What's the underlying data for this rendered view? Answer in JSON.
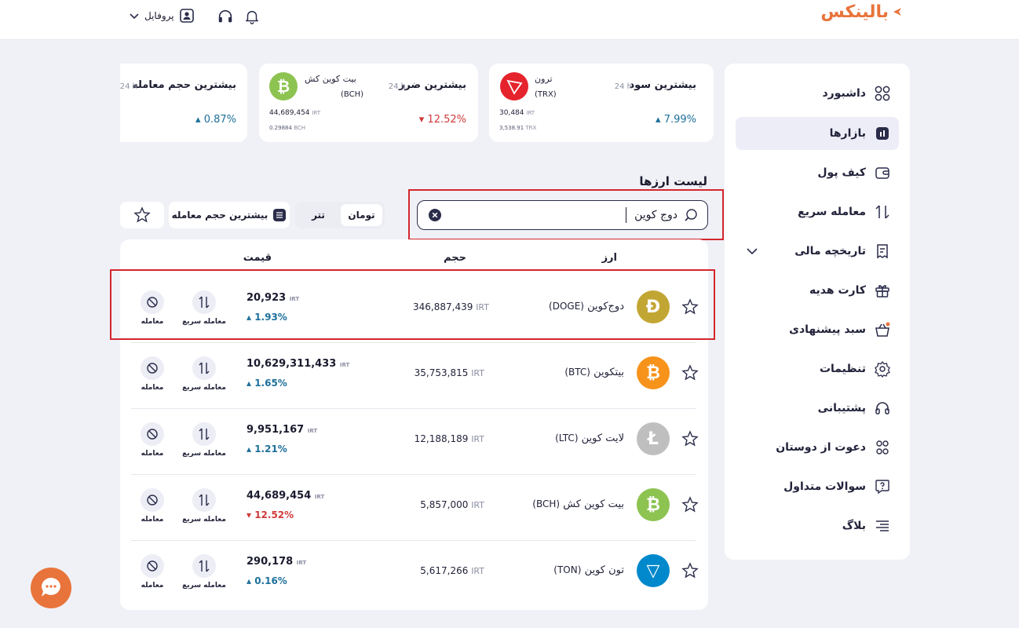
{
  "header": {
    "logo_text": "بالینکس",
    "profile_label": "پروفایل",
    "icons": [
      "user-icon",
      "headphones-icon",
      "bell-icon",
      "chevron-down-icon"
    ]
  },
  "sidebar": {
    "items": [
      {
        "label": "داشبورد",
        "icon": "grid-icon",
        "active": false
      },
      {
        "label": "بازارها",
        "icon": "chart-icon",
        "active": true
      },
      {
        "label": "کیف پول",
        "icon": "wallet-icon",
        "active": false
      },
      {
        "label": "معامله سریع",
        "icon": "swap-icon",
        "active": false
      },
      {
        "label": "تاریخچه مالی",
        "icon": "receipt-icon",
        "active": false
      },
      {
        "label": "کارت هدیه",
        "icon": "gift-icon",
        "active": false
      },
      {
        "label": "سبد پیشنهادی",
        "icon": "basket-icon",
        "active": false
      },
      {
        "label": "تنظیمات",
        "icon": "gear-icon",
        "active": false
      },
      {
        "label": "پشتیبانی",
        "icon": "headphones-icon",
        "active": false
      },
      {
        "label": "دعوت از دوستان",
        "icon": "people-icon",
        "active": false
      },
      {
        "label": "سوالات متداول",
        "icon": "faq-icon",
        "active": false
      },
      {
        "label": "بلاگ",
        "icon": "list-icon",
        "active": false
      }
    ]
  },
  "cards": [
    {
      "title": "بیشترین سود",
      "period": "24 h",
      "coin_name": "ترون",
      "coin_symbol": "(TRX)",
      "price": "30,484",
      "price_unit": "IRT",
      "sub": "3,538.91",
      "sub_unit": "TRX",
      "change": "7.99%",
      "direction": "up",
      "coin_color": "#e5232d"
    },
    {
      "title": "بیشترین ضرر",
      "period": "24 h",
      "coin_name": "بیت کوین کش",
      "coin_symbol": "(BCH)",
      "price": "44,689,454",
      "price_unit": "IRT",
      "sub": "0.29884",
      "sub_unit": "BCH",
      "change": "12.52%",
      "direction": "down",
      "coin_color": "#8dc351"
    },
    {
      "title": "بیشترین حجم معامله",
      "period": "24 h",
      "change": "0.87%",
      "direction": "up"
    }
  ],
  "list": {
    "title": "لیست ارزها",
    "search": {
      "value": "دوج کوین"
    },
    "filters": {
      "toman": "تومان",
      "tether": "تتر",
      "sort": "بیشترین حجم معامله"
    },
    "columns": {
      "asset": "ارز",
      "volume": "حجم",
      "price": "قیمت"
    },
    "actions": {
      "quick_trade": "معامله سریع",
      "trade": "معامله"
    },
    "rows": [
      {
        "name": "دوج‌کوین",
        "symbol": "(DOGE)",
        "volume": "346,887,439",
        "volume_unit": "IRT",
        "price": "20,923",
        "price_unit": "IRT",
        "change": "1.93%",
        "direction": "up",
        "color": "#c2a633",
        "glyph": "Ð"
      },
      {
        "name": "بیتکوین",
        "symbol": "(BTC)",
        "volume": "35,753,815",
        "volume_unit": "IRT",
        "price": "10,629,311,433",
        "price_unit": "IRT",
        "change": "1.65%",
        "direction": "up",
        "color": "#f7931a",
        "glyph": "₿"
      },
      {
        "name": "لایت کوین",
        "symbol": "(LTC)",
        "volume": "12,188,189",
        "volume_unit": "IRT",
        "price": "9,951,167",
        "price_unit": "IRT",
        "change": "1.21%",
        "direction": "up",
        "color": "#bfbfbf",
        "glyph": "Ł"
      },
      {
        "name": "بیت کوین کش",
        "symbol": "(BCH)",
        "volume": "5,857,000",
        "volume_unit": "IRT",
        "price": "44,689,454",
        "price_unit": "IRT",
        "change": "12.52%",
        "direction": "down",
        "color": "#8dc351",
        "glyph": "₿"
      },
      {
        "name": "تون کوین",
        "symbol": "(TON)",
        "volume": "5,617,266",
        "volume_unit": "IRT",
        "price": "290,178",
        "price_unit": "IRT",
        "change": "0.16%",
        "direction": "up",
        "color": "#0088cc",
        "glyph": "▽"
      }
    ]
  }
}
